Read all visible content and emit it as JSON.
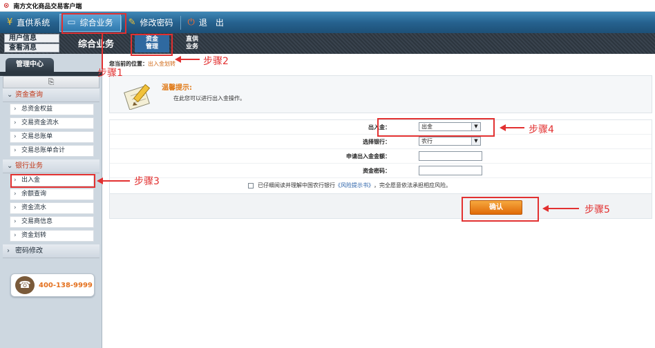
{
  "app": {
    "title": "南方文化商品交易客户端"
  },
  "toolbar": {
    "items": [
      {
        "icon": "yen-icon",
        "label": "直供系统"
      },
      {
        "icon": "monitor-icon",
        "label": "综合业务"
      },
      {
        "icon": "pen-icon",
        "label": "修改密码"
      },
      {
        "icon": "power-icon",
        "label": "退　出"
      }
    ]
  },
  "subnav": {
    "user_info": "用户信息",
    "view_messages": "查看消息",
    "section_title": "综合业务",
    "tabs": [
      {
        "line1": "资金",
        "line2": "管理"
      },
      {
        "line1": "直供",
        "line2": "业务"
      }
    ]
  },
  "sidebar": {
    "tab": "管理中心",
    "strip_icon": "export-icon",
    "categories": [
      {
        "label": "资金查询",
        "items": [
          "总资金权益",
          "交易资金流水",
          "交易总账单",
          "交易总账单合计"
        ]
      },
      {
        "label": "银行业务",
        "items": [
          "出入金",
          "余额查询",
          "资金流水",
          "交易商信息",
          "资金划转"
        ]
      },
      {
        "label": "密码修改",
        "items": []
      }
    ],
    "phone": "400-138-9999"
  },
  "main": {
    "breadcrumb_label": "您当前的位置：",
    "breadcrumb_value": "出入金划转",
    "tip_title": "温馨提示:",
    "tip_body": "在此您可以进行出入金操作。",
    "form": {
      "direction_label": "出入金：",
      "direction_value": "出金",
      "bank_label": "选择银行：",
      "bank_value": "农行",
      "amount_label": "申请出入金金额：",
      "amount_value": "",
      "password_label": "资金密码：",
      "password_value": "",
      "agree_prefix": "已仔细阅读并理解中国农行银行",
      "agree_link": "《风险提示书》",
      "agree_suffix": "，完全愿意依法承担相应风险。",
      "confirm": "确认"
    }
  },
  "annotations": {
    "step1": "步骤1",
    "step2": "步骤2",
    "step3": "步骤3",
    "step4": "步骤4",
    "step5": "步骤5"
  }
}
